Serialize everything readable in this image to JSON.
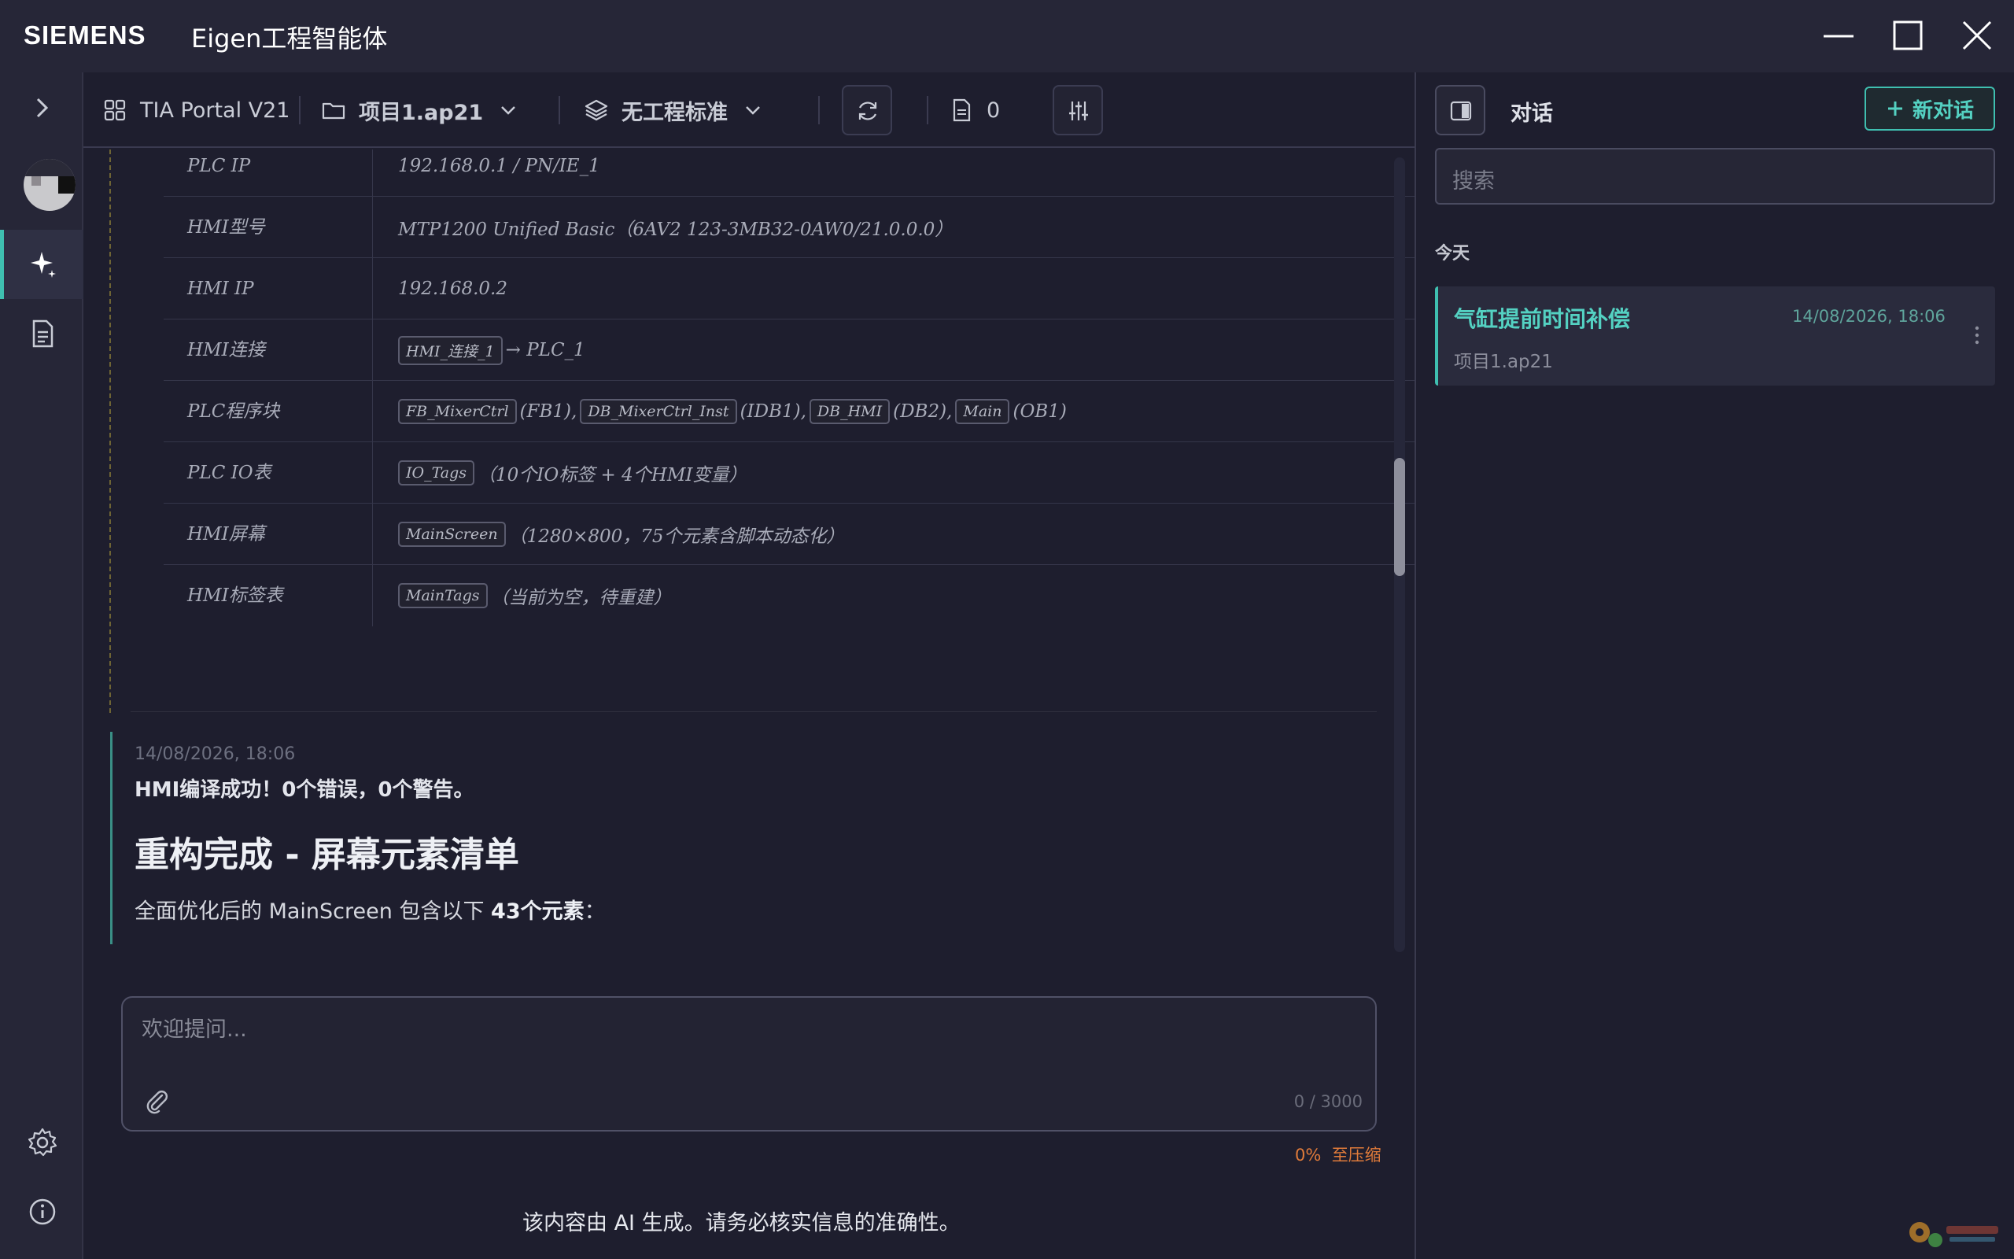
{
  "app": {
    "brand": "SIEMENS",
    "title": "Eigen工程智能体"
  },
  "toolbar": {
    "portal": "TIA Portal V21",
    "project": "项目1.ap21",
    "standard": "无工程标准",
    "file_count": "0"
  },
  "table": {
    "rows": [
      {
        "key": "PLC IP",
        "value": "192.168.0.1 / PN/IE_1"
      },
      {
        "key": "HMI型号",
        "value": "MTP1200 Unified Basic（6AV2 123-3MB32-0AW0/21.0.0.0）"
      },
      {
        "key": "HMI IP",
        "value": "192.168.0.2"
      },
      {
        "key": "HMI连接",
        "code1": "HMI_连接_1",
        "rest1": "→ PLC_1"
      },
      {
        "key": "PLC程序块",
        "code1": "FB_MixerCtrl",
        "rest1": "(FB1),",
        "code2": "DB_MixerCtrl_Inst",
        "rest2": "(IDB1),",
        "code3": "DB_HMI",
        "rest3": "(DB2),",
        "code4": "Main",
        "rest4": "(OB1)"
      },
      {
        "key": "PLC IO表",
        "code1": "IO_Tags",
        "rest1": "（10个IO标签 + 4个HMI变量）"
      },
      {
        "key": "HMI屏幕",
        "code1": "MainScreen",
        "rest1": "（1280×800，75个元素含脚本动态化）"
      },
      {
        "key": "HMI标签表",
        "code1": "MainTags",
        "rest1": "（当前为空，待重建）"
      }
    ]
  },
  "message": {
    "time": "14/08/2026, 18:06",
    "summary": "HMI编译成功！0个错误，0个警告。",
    "heading": "重构完成 - 屏幕元素清单",
    "para_prefix": "全面优化后的 MainScreen 包含以下 ",
    "para_bold": "43个元素",
    "para_suffix": "："
  },
  "input": {
    "placeholder": "欢迎提问...",
    "counter": "0 / 3000"
  },
  "compress": {
    "percent": "0%",
    "label": "至压缩"
  },
  "disclaimer": "该内容由 AI 生成。请务必核实信息的准确性。",
  "panel": {
    "title": "对话",
    "new_chat": "新对话",
    "search_placeholder": "搜索",
    "group_today": "今天",
    "conversations": [
      {
        "title": "气缸提前时间补偿",
        "date": "14/08/2026, 18:06",
        "project": "项目1.ap21"
      }
    ]
  },
  "colors": {
    "accent": "#3fbfb0",
    "background": "#1e1e2e",
    "warning": "#e07b3a"
  }
}
